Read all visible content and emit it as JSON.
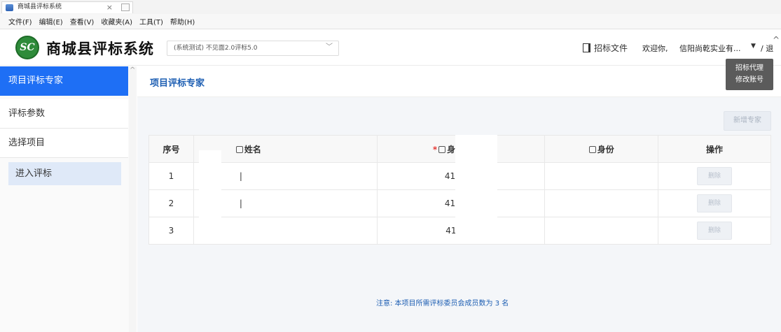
{
  "browser": {
    "tab_title": "商城县评标系统",
    "tab_close": "×"
  },
  "menu": [
    "文件(F)",
    "编辑(E)",
    "查看(V)",
    "收藏夹(A)",
    "工具(T)",
    "帮助(H)"
  ],
  "header": {
    "logo_text": "SC",
    "app_title": "商城县评标系统",
    "project_select_value": "(系统测试) 不见面2.0评标5.0",
    "doc_link": "招标文件",
    "welcome": "欢迎你,",
    "user_name": "信阳尚乾实业有...",
    "caret": "▼",
    "logout": "/ 退"
  },
  "user_dropdown": [
    "招标代理",
    "修改账号"
  ],
  "sidebar": {
    "items": [
      {
        "label": "项目评标专家",
        "active": true
      },
      {
        "label": "评标参数",
        "active": false
      },
      {
        "label": "选择项目",
        "active": false
      }
    ],
    "sub_item": "进入评标"
  },
  "main": {
    "title": "项目评标专家",
    "add_button": "新增专家",
    "columns": [
      "序号",
      "姓名",
      "身份证号码",
      "身份",
      "操作"
    ],
    "rows": [
      {
        "index": "1",
        "name": "|",
        "id_number": "411**  3",
        "role": "",
        "action": "删除"
      },
      {
        "index": "2",
        "name": "|",
        "id_number": "411**  7",
        "role": "",
        "action": "删除"
      },
      {
        "index": "3",
        "name": "",
        "id_number": "413**  (",
        "role": "",
        "action": "删除"
      }
    ],
    "notice": "注意: 本项目所需评标委员会成员数为 3 名"
  },
  "colors": {
    "accent": "#1e6ff5",
    "title_blue": "#1e5fb3",
    "required": "#e53935"
  }
}
